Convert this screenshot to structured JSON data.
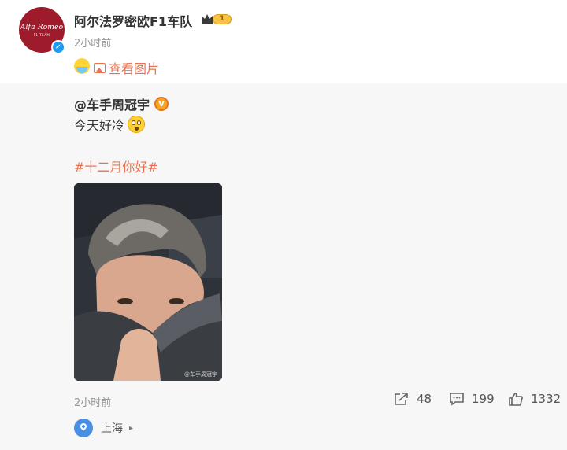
{
  "post": {
    "author": "阿尔法罗密欧F1车队",
    "avatar_brand": "Alfa Romeo",
    "avatar_sub": "F1 TEAM",
    "level": "1",
    "time": "2小时前",
    "view_picture": "查看图片"
  },
  "repost": {
    "author": "@车手周冠宇",
    "text": "今天好冷",
    "hashtag": "#十二月你好#",
    "watermark": "@车手周冠宇",
    "time": "2小时前",
    "shares": "48",
    "comments": "199",
    "likes": "1332",
    "location": "上海"
  },
  "colors": {
    "accent": "#eb7350",
    "verified_blue": "#1d9bf0",
    "avatar_red": "#9e1b2c"
  }
}
